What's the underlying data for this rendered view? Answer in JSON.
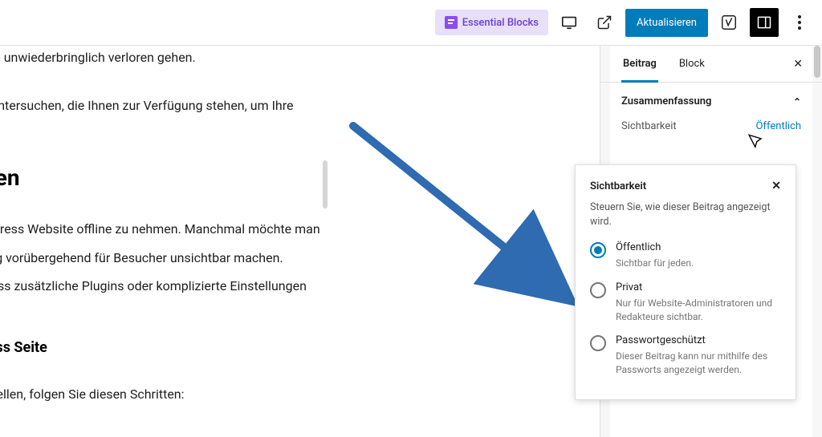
{
  "topbar": {
    "essential_blocks_label": "Essential Blocks",
    "update_label": "Aktualisieren"
  },
  "content": {
    "p1": "e Inhalte unwiederbringlich verloren gehen.",
    "p2": "tionen untersuchen, die Ihnen zur Verfügung stehen, um Ihre",
    "h2": " stellen",
    "p3": "e WordPress Website offline zu nehmen. Manchmal möchte man",
    "p4": "n Beitrag vorübergehend für Besucher unsichtbar machen.",
    "p5": "ohne dass zusätzliche Plugins oder komplizierte Einstellungen",
    "h3": "ordPress Seite",
    "p6": "ne zu stellen, folgen Sie diesen Schritten:"
  },
  "sidebar": {
    "tabs": {
      "post": "Beitrag",
      "block": "Block"
    },
    "summary_label": "Zusammenfassung",
    "visibility_label": "Sichtbarkeit",
    "visibility_value": "Öffentlich"
  },
  "popover": {
    "title": "Sichtbarkeit",
    "desc": "Steuern Sie, wie dieser Beitrag angezeigt wird.",
    "options": [
      {
        "label": "Öffentlich",
        "desc": "Sichtbar für jeden.",
        "selected": true
      },
      {
        "label": "Privat",
        "desc": "Nur für Website-Administratoren und Redakteure sichtbar.",
        "selected": false
      },
      {
        "label": "Passwortgeschützt",
        "desc": "Dieser Beitrag kann nur mithilfe des Passworts angezeigt werden.",
        "selected": false
      }
    ]
  }
}
